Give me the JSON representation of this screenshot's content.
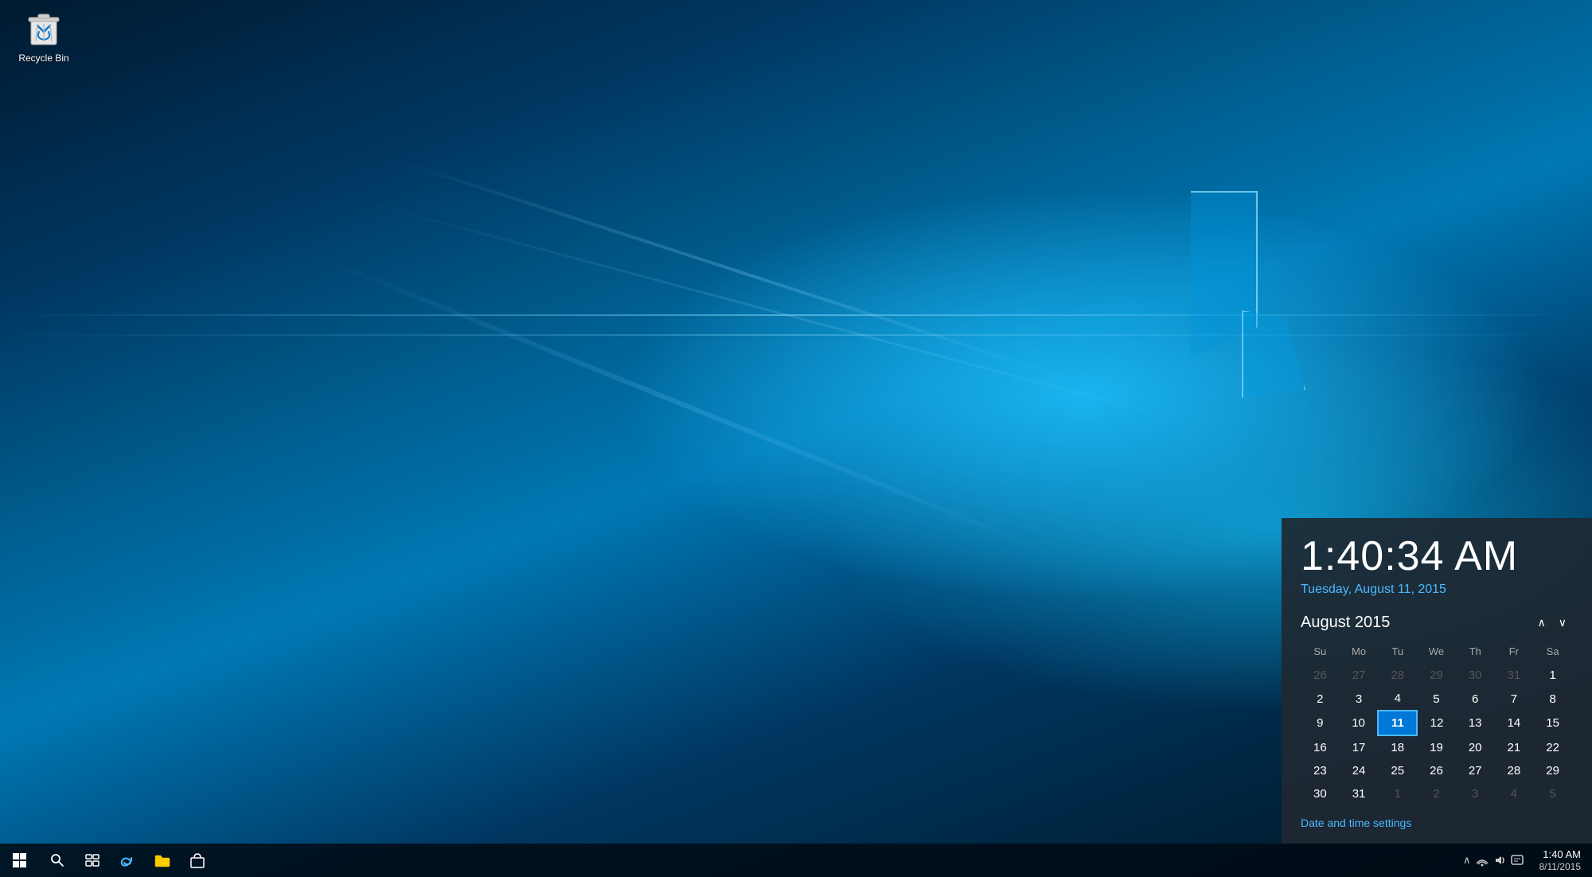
{
  "desktop": {
    "background_description": "Windows 10 default hero wallpaper blue gradient"
  },
  "recycle_bin": {
    "label": "Recycle Bin"
  },
  "calendar_popup": {
    "time": "1:40:34 AM",
    "date": "Tuesday, August 11, 2015",
    "month_year": "August 2015",
    "nav_prev_label": "∧",
    "nav_next_label": "∨",
    "day_headers": [
      "Su",
      "Mo",
      "Tu",
      "We",
      "Th",
      "Fr",
      "Sa"
    ],
    "weeks": [
      [
        {
          "day": "26",
          "type": "other"
        },
        {
          "day": "27",
          "type": "other"
        },
        {
          "day": "28",
          "type": "other"
        },
        {
          "day": "29",
          "type": "other"
        },
        {
          "day": "30",
          "type": "other"
        },
        {
          "day": "31",
          "type": "other"
        },
        {
          "day": "1",
          "type": "current"
        }
      ],
      [
        {
          "day": "2",
          "type": "current"
        },
        {
          "day": "3",
          "type": "current"
        },
        {
          "day": "4",
          "type": "current"
        },
        {
          "day": "5",
          "type": "current"
        },
        {
          "day": "6",
          "type": "current"
        },
        {
          "day": "7",
          "type": "current"
        },
        {
          "day": "8",
          "type": "current"
        }
      ],
      [
        {
          "day": "9",
          "type": "current"
        },
        {
          "day": "10",
          "type": "current"
        },
        {
          "day": "11",
          "type": "today"
        },
        {
          "day": "12",
          "type": "current"
        },
        {
          "day": "13",
          "type": "current"
        },
        {
          "day": "14",
          "type": "current"
        },
        {
          "day": "15",
          "type": "current"
        }
      ],
      [
        {
          "day": "16",
          "type": "current"
        },
        {
          "day": "17",
          "type": "current"
        },
        {
          "day": "18",
          "type": "current"
        },
        {
          "day": "19",
          "type": "current"
        },
        {
          "day": "20",
          "type": "current"
        },
        {
          "day": "21",
          "type": "current"
        },
        {
          "day": "22",
          "type": "current"
        }
      ],
      [
        {
          "day": "23",
          "type": "current"
        },
        {
          "day": "24",
          "type": "current"
        },
        {
          "day": "25",
          "type": "current"
        },
        {
          "day": "26",
          "type": "current"
        },
        {
          "day": "27",
          "type": "current"
        },
        {
          "day": "28",
          "type": "current"
        },
        {
          "day": "29",
          "type": "current"
        }
      ],
      [
        {
          "day": "30",
          "type": "current"
        },
        {
          "day": "31",
          "type": "current"
        },
        {
          "day": "1",
          "type": "other"
        },
        {
          "day": "2",
          "type": "other"
        },
        {
          "day": "3",
          "type": "other"
        },
        {
          "day": "4",
          "type": "other"
        },
        {
          "day": "5",
          "type": "other"
        }
      ]
    ],
    "settings_link": "Date and time settings"
  },
  "taskbar": {
    "start_icon": "⊞",
    "search_icon": "🔍",
    "task_view_icon": "⧉",
    "edge_icon": "e",
    "explorer_icon": "📁",
    "store_icon": "🛍",
    "tray_chevron": "∧",
    "network_icon": "📶",
    "volume_icon": "🔊",
    "time": "1:40 AM",
    "date": "8/11/2015"
  }
}
